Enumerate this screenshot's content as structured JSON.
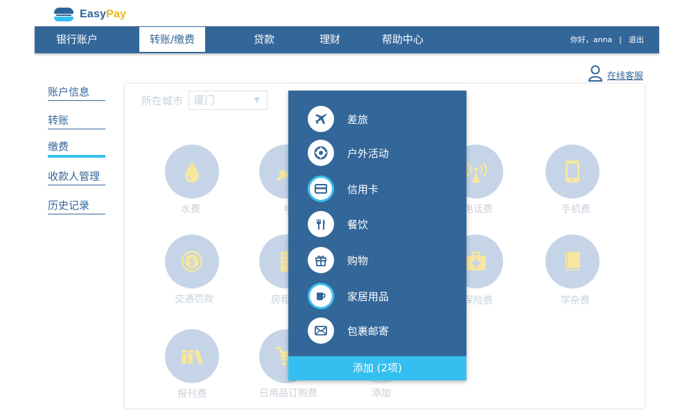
{
  "brand": {
    "easy": "Easy",
    "pay": "Pay"
  },
  "nav": {
    "items": [
      {
        "label": "银行账户"
      },
      {
        "label": "转账/缴费"
      },
      {
        "label": "贷款"
      },
      {
        "label": "理财"
      },
      {
        "label": "帮助中心"
      }
    ],
    "greeting": "你好，anna",
    "separator": "|",
    "logout": "退出"
  },
  "service": {
    "label": "在线客服",
    "icon": "person-icon"
  },
  "sidebar": {
    "items": [
      {
        "label": "账户信息"
      },
      {
        "label": "转账"
      },
      {
        "label": "缴费"
      },
      {
        "label": "收款人管理"
      },
      {
        "label": "历史记录"
      }
    ]
  },
  "filter": {
    "label": "所在城市",
    "value": "厦门",
    "caret": "▼"
  },
  "bills": [
    {
      "label": "水费",
      "icon": "water-drop-icon"
    },
    {
      "label": "电",
      "icon": "plug-icon"
    },
    {
      "label": "电话费",
      "icon": "signal-tower-icon"
    },
    {
      "label": "手机费",
      "icon": "mobile-phone-icon"
    },
    {
      "label": "交通罚款",
      "icon": "dollar-coin-icon"
    },
    {
      "label": "房租物",
      "icon": "building-icon"
    },
    {
      "label": "保险费",
      "icon": "medical-kit-icon"
    },
    {
      "label": "学杂费",
      "icon": "book-icon"
    },
    {
      "label": "报刊费",
      "icon": "books-icon"
    },
    {
      "label": "日用品订购费",
      "icon": "cart-icon"
    },
    {
      "label": "添加",
      "icon": "add-icon"
    }
  ],
  "dropdown": {
    "items": [
      {
        "label": "差旅",
        "icon": "airplane-icon",
        "checked": false
      },
      {
        "label": "户外活动",
        "icon": "lifebuoy-icon",
        "checked": false
      },
      {
        "label": "信用卡",
        "icon": "credit-card-icon",
        "checked": true
      },
      {
        "label": "餐饮",
        "icon": "fork-knife-icon",
        "checked": false
      },
      {
        "label": "购物",
        "icon": "gift-icon",
        "checked": false
      },
      {
        "label": "家居用品",
        "icon": "cup-icon",
        "checked": true
      },
      {
        "label": "包裹邮寄",
        "icon": "envelope-icon",
        "checked": false
      }
    ],
    "add_label": "添加 (2项)"
  },
  "colors": {
    "primary": "#336699",
    "accent": "#35bff0",
    "icon_bg": "#c5d5e7",
    "icon_fg": "#f7e6a0",
    "muted_text": "#c8d0da"
  }
}
